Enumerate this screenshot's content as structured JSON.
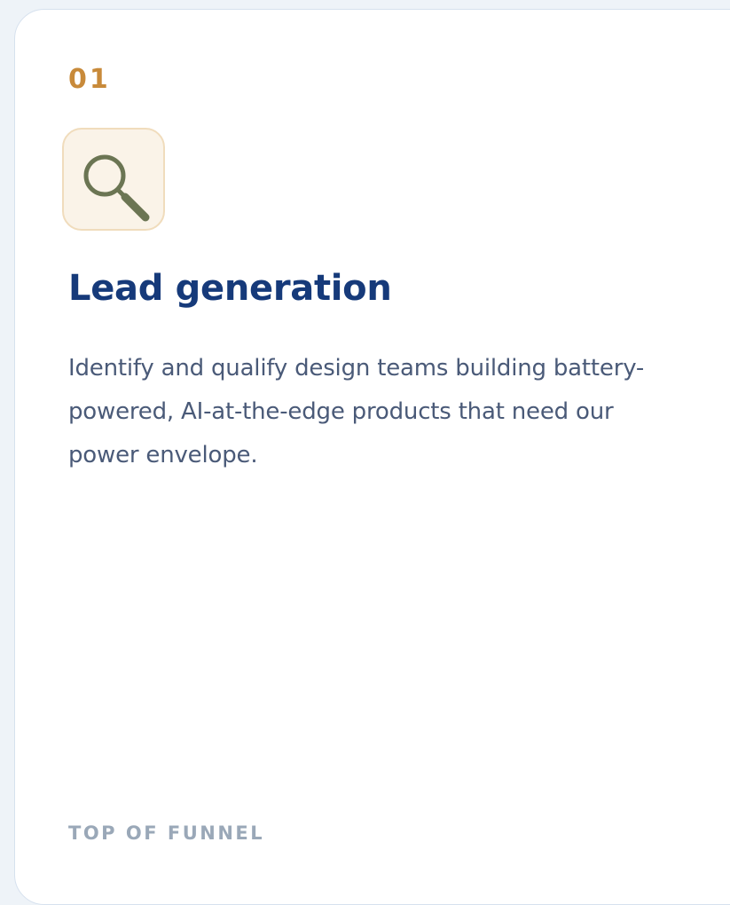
{
  "card": {
    "step_number": "01",
    "icon": "search-icon",
    "title": "Lead generation",
    "description": "Identify and qualify design teams building battery-powered, AI-at-the-edge products that need our power envelope.",
    "stage_label": "TOP OF FUNNEL"
  },
  "colors": {
    "page_background": "#eef3f8",
    "card_background": "#ffffff",
    "card_border": "#d6e1ee",
    "step_number": "#c88a3a",
    "icon_tile_background": "#faf3e8",
    "icon_tile_border": "#f0dcbc",
    "icon_stroke": "#6b7553",
    "title": "#163a7a",
    "description": "#4a5a78",
    "stage_label": "#9aa8b8"
  }
}
